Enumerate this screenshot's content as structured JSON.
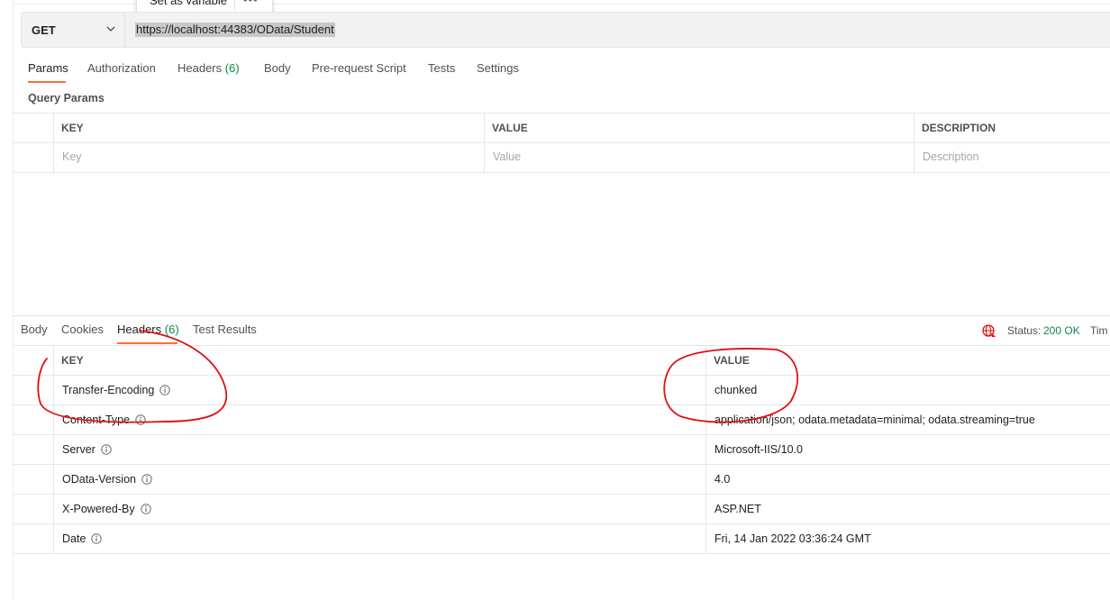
{
  "popup": {
    "label": "Set as variable",
    "more": "•••"
  },
  "request": {
    "method": "GET",
    "url": "https://localhost:44383/OData/Student"
  },
  "request_tabs": [
    {
      "label": "Params"
    },
    {
      "label": "Authorization"
    },
    {
      "label": "Headers",
      "count": "(6)"
    },
    {
      "label": "Body"
    },
    {
      "label": "Pre-request Script"
    },
    {
      "label": "Tests"
    },
    {
      "label": "Settings"
    }
  ],
  "query_params": {
    "title": "Query Params",
    "columns": [
      "KEY",
      "VALUE",
      "DESCRIPTION"
    ],
    "placeholders": [
      "Key",
      "Value",
      "Description"
    ]
  },
  "response_tabs": [
    {
      "label": "Body"
    },
    {
      "label": "Cookies"
    },
    {
      "label": "Headers",
      "count": "(6)"
    },
    {
      "label": "Test Results"
    }
  ],
  "status": {
    "label": "Status:",
    "value": "200 OK",
    "time_label": "Tim"
  },
  "response_headers": {
    "columns": [
      "KEY",
      "VALUE"
    ],
    "rows": [
      {
        "key": "Transfer-Encoding",
        "value": "chunked"
      },
      {
        "key": "Content-Type",
        "value": "application/json; odata.metadata=minimal; odata.streaming=true"
      },
      {
        "key": "Server",
        "value": "Microsoft-IIS/10.0"
      },
      {
        "key": "OData-Version",
        "value": "4.0"
      },
      {
        "key": "X-Powered-By",
        "value": "ASP.NET"
      },
      {
        "key": "Date",
        "value": "Fri, 14 Jan 2022 03:36:24 GMT"
      }
    ]
  },
  "colors": {
    "accent": "#ff6c37",
    "success": "#0f8a4a",
    "annotation": "#e01010"
  }
}
